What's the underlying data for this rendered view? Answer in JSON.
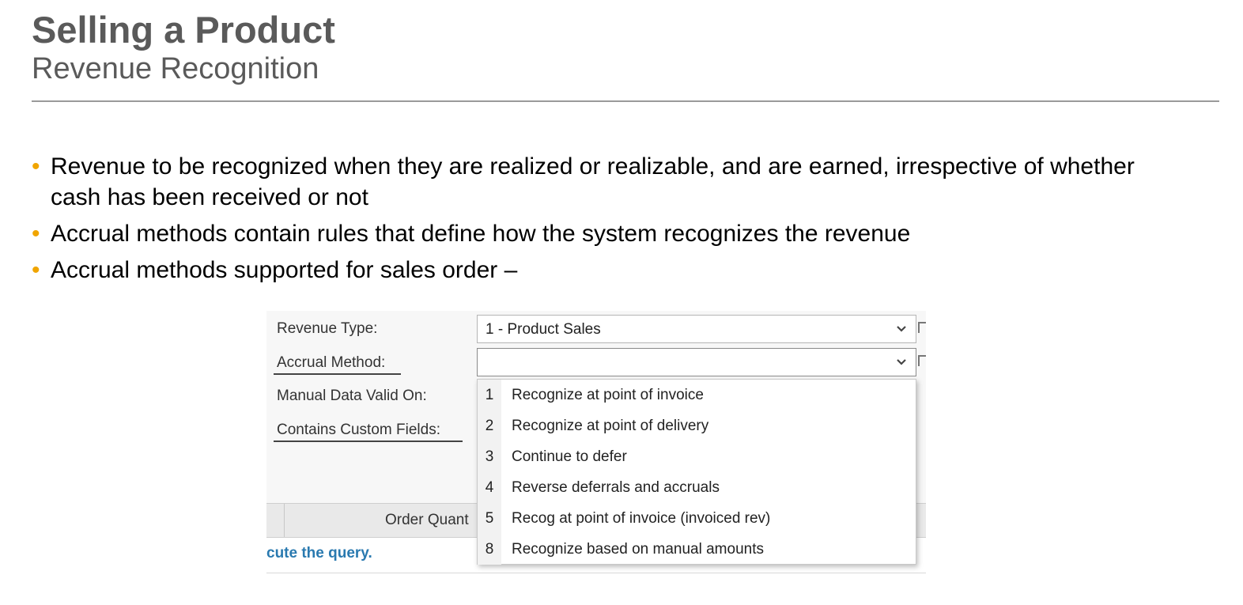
{
  "slide": {
    "title": "Selling a Product",
    "subtitle": "Revenue Recognition",
    "bullets": [
      "Revenue to be recognized when they are realized or realizable, and are earned, irrespective of whether cash has been received or not",
      "Accrual methods contain rules that define how the system recognizes the revenue",
      "Accrual methods supported for sales order –"
    ]
  },
  "form": {
    "revenue_type_label": "Revenue Type:",
    "revenue_type_value": "1 - Product Sales",
    "accrual_method_label": "Accrual Method:",
    "accrual_method_value": "",
    "manual_data_label": "Manual Data Valid On:",
    "custom_fields_label": "Contains Custom Fields:"
  },
  "grid": {
    "column_header": "Order Quant",
    "hint_text": "cute the query."
  },
  "dropdown": {
    "options": [
      {
        "code": "1",
        "label": "Recognize at point of invoice"
      },
      {
        "code": "2",
        "label": "Recognize at point of delivery"
      },
      {
        "code": "3",
        "label": "Continue to defer"
      },
      {
        "code": "4",
        "label": "Reverse deferrals and accruals"
      },
      {
        "code": "5",
        "label": "Recog at point of invoice (invoiced rev)"
      },
      {
        "code": "8",
        "label": "Recognize based on manual amounts"
      }
    ]
  },
  "colors": {
    "bullet_accent": "#f0a500",
    "title_gray": "#5a5a5a",
    "hint_blue": "#2a7ab0"
  },
  "icons": [
    "chevron-down-icon",
    "bullet-icon"
  ]
}
